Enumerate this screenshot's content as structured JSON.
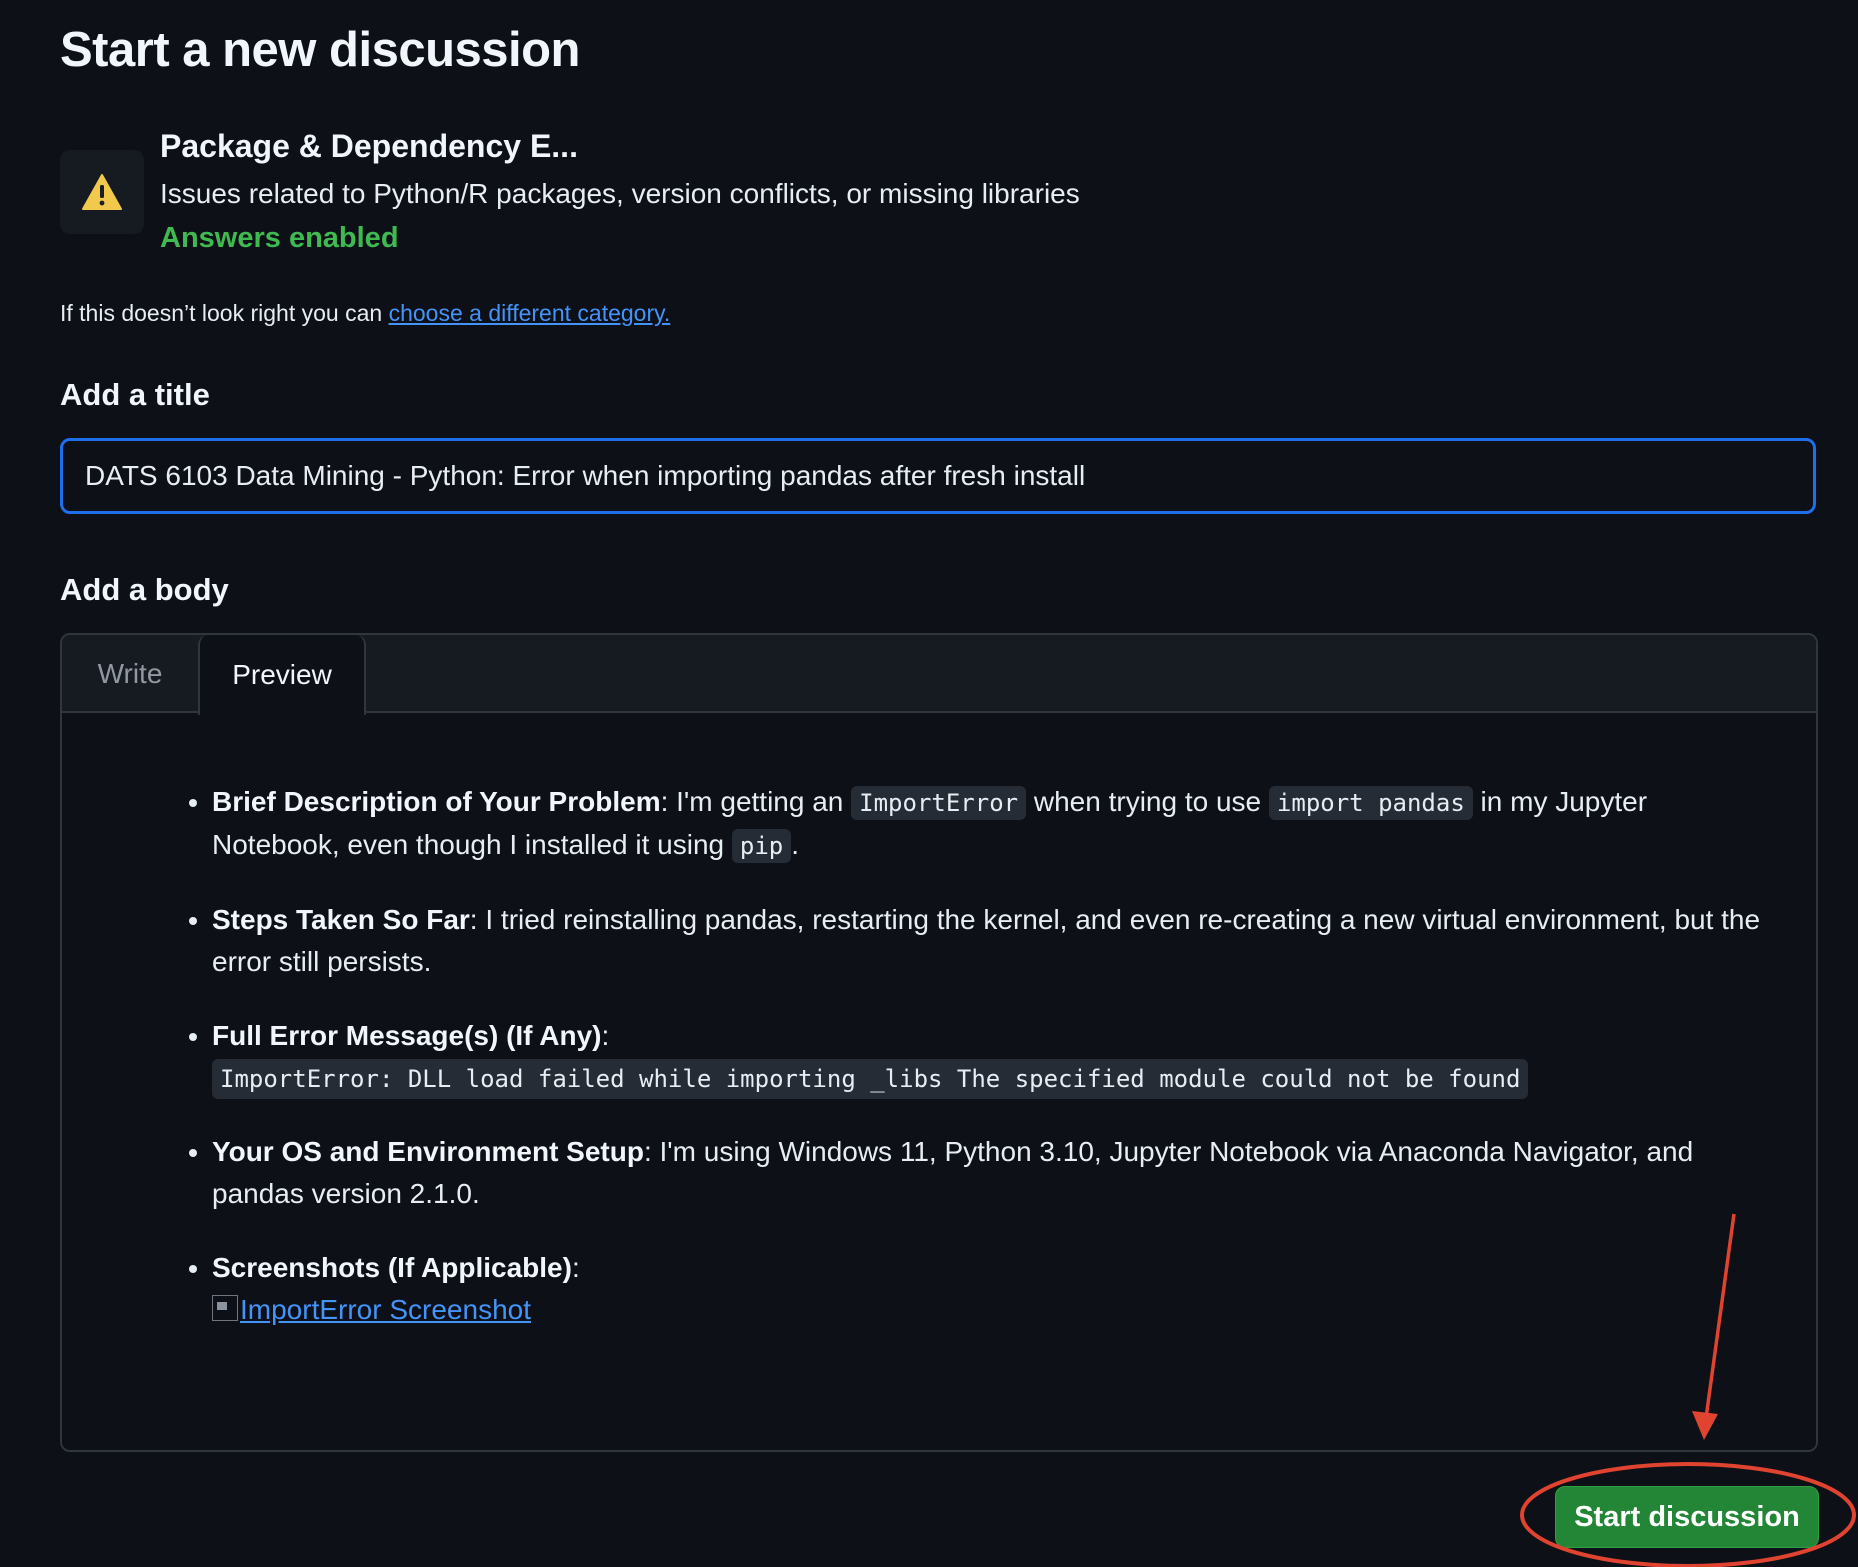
{
  "page": {
    "title": "Start a new discussion"
  },
  "category": {
    "icon": "warning-icon",
    "name": "Package & Dependency E...",
    "description": "Issues related to Python/R packages, version conflicts, or missing libraries",
    "answers_status": "Answers enabled",
    "change_prefix": "If this doesn’t look right you can ",
    "change_link": "choose a different category."
  },
  "title_section": {
    "label": "Add a title",
    "value": "DATS 6103 Data Mining - Python: Error when importing pandas after fresh install"
  },
  "body_section": {
    "label": "Add a body",
    "tabs": [
      "Write",
      "Preview"
    ],
    "active_tab": "Preview",
    "items": [
      {
        "heading": "Brief Description of Your Problem",
        "text_1": ": I'm getting an ",
        "code_1": "ImportError",
        "text_2": " when trying to use ",
        "code_2": "import pandas",
        "text_3": " in my Jupyter Notebook, even though I installed it using ",
        "code_3": "pip",
        "text_4": "."
      },
      {
        "heading": "Steps Taken So Far",
        "text": ": I tried reinstalling pandas, restarting the kernel, and even re-creating a new virtual environment, but the error still persists."
      },
      {
        "heading": "Full Error Message(s) (If Any)",
        "text": ":",
        "code": "ImportError: DLL load failed while importing _libs The specified module could not be found"
      },
      {
        "heading": "Your OS and Environment Setup",
        "text": ": I'm using Windows 11, Python 3.10, Jupyter Notebook via Anaconda Navigator, and pandas version 2.1.0."
      },
      {
        "heading": "Screenshots (If Applicable)",
        "text": ":",
        "link": "ImportError Screenshot"
      }
    ]
  },
  "actions": {
    "submit_label": "Start discussion"
  },
  "colors": {
    "background": "#0d1117",
    "accent_link": "#4493f8",
    "success_green": "#3fb950",
    "button_green": "#238636",
    "focus_border": "#1f6feb",
    "annotation_red": "#e0432f",
    "warning_yellow": "#d29922"
  }
}
